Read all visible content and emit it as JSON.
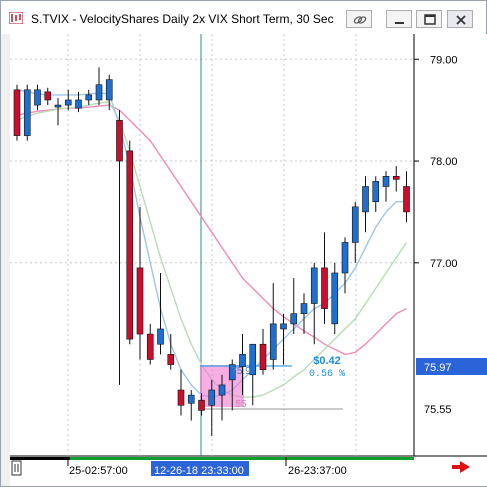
{
  "window": {
    "title": "S.TVIX - VelocityShares Daily 2x VIX Short Term, 30 Sec"
  },
  "colors": {
    "up": "#1f6fd1",
    "down": "#c8102e",
    "ma_fast": "#9cc6ea",
    "ma_mid": "#b8dcb8",
    "ma_slow": "#f08cb8",
    "cursor_line": "#2e8b8b",
    "price_label_bg": "#2b63d9",
    "gain_text": "#1f8de0",
    "selection_box": "#f07ad0"
  },
  "price_axis": {
    "ticks": [
      "79.00",
      "78.00",
      "77.00"
    ],
    "last_price_label": "75.97",
    "reference_label": "75.55"
  },
  "time_axis": {
    "labels": [
      "25-02:57:00",
      "12-26-18 23:33:00",
      "26-23:37:00"
    ]
  },
  "measure": {
    "box_high": "75.9",
    "box_low": "55",
    "gain": "$0.42",
    "gain_pct": "0.56 %"
  },
  "chart_data": {
    "type": "candlestick",
    "ylim": [
      75.2,
      79.15
    ],
    "candles": [
      {
        "o": 78.7,
        "h": 78.75,
        "l": 78.2,
        "c": 78.25
      },
      {
        "o": 78.25,
        "h": 78.75,
        "l": 78.2,
        "c": 78.7
      },
      {
        "o": 78.55,
        "h": 78.75,
        "l": 78.5,
        "c": 78.7
      },
      {
        "o": 78.68,
        "h": 78.72,
        "l": 78.55,
        "c": 78.6
      },
      {
        "o": 78.55,
        "h": 78.62,
        "l": 78.35,
        "c": 78.55
      },
      {
        "o": 78.55,
        "h": 78.7,
        "l": 78.5,
        "c": 78.6
      },
      {
        "o": 78.52,
        "h": 78.68,
        "l": 78.48,
        "c": 78.6
      },
      {
        "o": 78.6,
        "h": 78.7,
        "l": 78.55,
        "c": 78.65
      },
      {
        "o": 78.6,
        "h": 78.92,
        "l": 78.55,
        "c": 78.75
      },
      {
        "o": 78.6,
        "h": 78.85,
        "l": 78.5,
        "c": 78.8
      },
      {
        "o": 78.4,
        "h": 78.5,
        "l": 75.8,
        "c": 78.0
      },
      {
        "o": 78.1,
        "h": 78.2,
        "l": 76.2,
        "c": 76.25
      },
      {
        "o": 76.95,
        "h": 77.55,
        "l": 76.05,
        "c": 76.3
      },
      {
        "o": 76.3,
        "h": 76.4,
        "l": 76.0,
        "c": 76.05
      },
      {
        "o": 76.2,
        "h": 76.9,
        "l": 76.1,
        "c": 76.35
      },
      {
        "o": 76.1,
        "h": 76.3,
        "l": 75.95,
        "c": 76.0
      },
      {
        "o": 75.75,
        "h": 75.95,
        "l": 75.5,
        "c": 75.6
      },
      {
        "o": 75.62,
        "h": 75.75,
        "l": 75.45,
        "c": 75.7
      },
      {
        "o": 75.65,
        "h": 75.72,
        "l": 75.5,
        "c": 75.55
      },
      {
        "o": 75.6,
        "h": 75.85,
        "l": 75.3,
        "c": 75.75
      },
      {
        "o": 75.7,
        "h": 75.9,
        "l": 75.45,
        "c": 75.8
      },
      {
        "o": 75.85,
        "h": 76.05,
        "l": 75.55,
        "c": 76.0
      },
      {
        "o": 75.98,
        "h": 76.3,
        "l": 75.7,
        "c": 76.1
      },
      {
        "o": 75.9,
        "h": 76.2,
        "l": 75.6,
        "c": 76.2
      },
      {
        "o": 76.2,
        "h": 76.35,
        "l": 75.9,
        "c": 75.95
      },
      {
        "o": 76.05,
        "h": 76.8,
        "l": 75.95,
        "c": 76.4
      },
      {
        "o": 76.35,
        "h": 76.5,
        "l": 76.0,
        "c": 76.4
      },
      {
        "o": 76.4,
        "h": 76.85,
        "l": 76.3,
        "c": 76.5
      },
      {
        "o": 76.5,
        "h": 76.7,
        "l": 76.3,
        "c": 76.6
      },
      {
        "o": 76.6,
        "h": 77.0,
        "l": 76.2,
        "c": 76.95
      },
      {
        "o": 76.95,
        "h": 77.3,
        "l": 76.4,
        "c": 76.55
      },
      {
        "o": 76.4,
        "h": 77.0,
        "l": 76.3,
        "c": 76.9
      },
      {
        "o": 76.9,
        "h": 77.25,
        "l": 76.7,
        "c": 77.2
      },
      {
        "o": 77.2,
        "h": 77.6,
        "l": 77.0,
        "c": 77.55
      },
      {
        "o": 77.5,
        "h": 77.85,
        "l": 77.3,
        "c": 77.75
      },
      {
        "o": 77.6,
        "h": 77.85,
        "l": 77.5,
        "c": 77.8
      },
      {
        "o": 77.75,
        "h": 77.9,
        "l": 77.6,
        "c": 77.85
      },
      {
        "o": 77.85,
        "h": 77.95,
        "l": 77.7,
        "c": 77.82
      },
      {
        "o": 77.75,
        "h": 77.9,
        "l": 77.4,
        "c": 77.5
      }
    ],
    "ma_fast": [
      78.7,
      78.68,
      78.66,
      78.65,
      78.65,
      78.65,
      78.65,
      78.66,
      78.67,
      78.66,
      78.35,
      77.95,
      77.45,
      77.0,
      76.55,
      76.2,
      75.95,
      75.8,
      75.7,
      75.68,
      75.7,
      75.75,
      75.85,
      75.95,
      76.05,
      76.15,
      76.25,
      76.35,
      76.45,
      76.55,
      76.6,
      76.7,
      76.8,
      76.95,
      77.15,
      77.35,
      77.5,
      77.6,
      77.6
    ],
    "ma_mid": [
      78.4,
      78.44,
      78.47,
      78.49,
      78.51,
      78.52,
      78.53,
      78.55,
      78.57,
      78.58,
      78.4,
      78.1,
      77.75,
      77.4,
      77.05,
      76.75,
      76.45,
      76.2,
      76.0,
      75.85,
      75.75,
      75.7,
      75.68,
      75.68,
      75.7,
      75.75,
      75.8,
      75.88,
      75.95,
      76.05,
      76.15,
      76.25,
      76.35,
      76.45,
      76.6,
      76.75,
      76.9,
      77.05,
      77.2
    ],
    "ma_slow": [
      78.45,
      78.47,
      78.49,
      78.5,
      78.51,
      78.52,
      78.52,
      78.53,
      78.54,
      78.55,
      78.5,
      78.4,
      78.3,
      78.2,
      78.05,
      77.9,
      77.75,
      77.6,
      77.45,
      77.3,
      77.15,
      77.0,
      76.85,
      76.75,
      76.65,
      76.55,
      76.47,
      76.4,
      76.33,
      76.27,
      76.2,
      76.15,
      76.1,
      76.12,
      76.2,
      76.3,
      76.4,
      76.5,
      76.55
    ]
  }
}
